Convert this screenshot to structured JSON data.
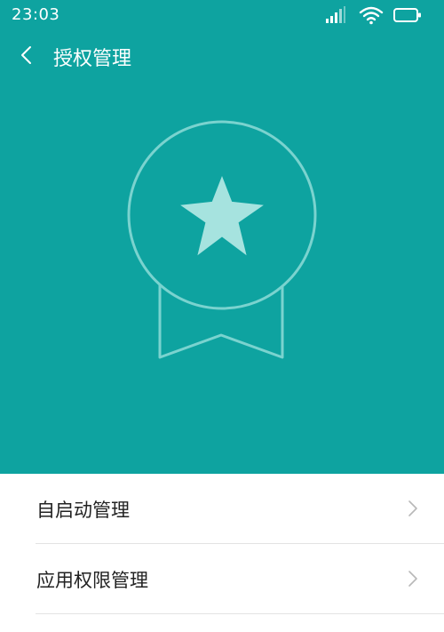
{
  "status_bar": {
    "time": "23:03"
  },
  "header": {
    "title": "授权管理"
  },
  "list": {
    "items": [
      {
        "label": "自启动管理"
      },
      {
        "label": "应用权限管理"
      }
    ]
  },
  "colors": {
    "accent": "#0ea3a0",
    "badge_line": "#7ad3cf",
    "star": "#a6e3df"
  },
  "icons": [
    "back-icon",
    "signal-icon",
    "wifi-icon",
    "battery-icon",
    "medal-icon",
    "star-icon",
    "chevron-right-icon"
  ]
}
